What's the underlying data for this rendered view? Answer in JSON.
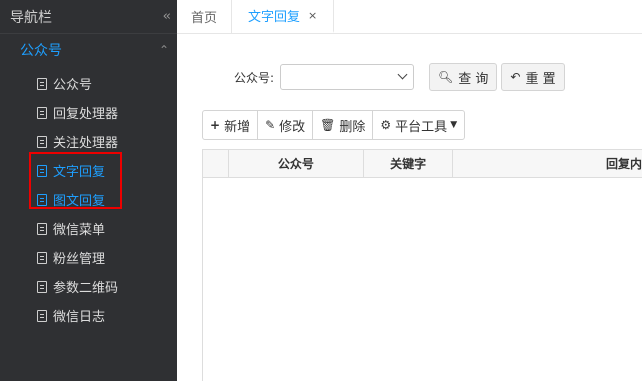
{
  "sidebar": {
    "title": "导航栏",
    "collapse_icon": "double-chevron-left-icon",
    "group": {
      "label": "公众号",
      "arrow_icon": "double-chevron-up-icon"
    },
    "items": [
      {
        "label": "公众号",
        "active": false
      },
      {
        "label": "回复处理器",
        "active": false
      },
      {
        "label": "关注处理器",
        "active": false
      },
      {
        "label": "文字回复",
        "active": true
      },
      {
        "label": "图文回复",
        "active": true
      },
      {
        "label": "微信菜单",
        "active": false
      },
      {
        "label": "粉丝管理",
        "active": false
      },
      {
        "label": "参数二维码",
        "active": false
      },
      {
        "label": "微信日志",
        "active": false
      }
    ]
  },
  "tabs": [
    {
      "label": "首页"
    },
    {
      "label": "文字回复",
      "close": "×"
    }
  ],
  "filter": {
    "label": "公众号:",
    "select_value": "",
    "search_label": "查 询",
    "reset_label": "重 置"
  },
  "toolbar": {
    "add_label": "新增",
    "edit_label": "修改",
    "delete_label": "删除",
    "tools_label": "平台工具"
  },
  "table": {
    "columns": [
      "",
      "公众号",
      "关键字",
      "回复内"
    ]
  },
  "colors": {
    "sidebar_bg": "#2f3033",
    "accent": "#1e9fff",
    "highlight": "#ee0000"
  }
}
